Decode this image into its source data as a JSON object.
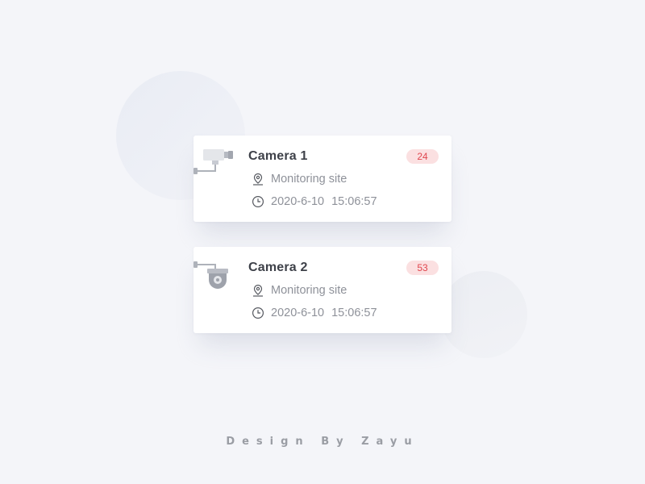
{
  "cameras": [
    {
      "name": "Camera 1",
      "count": "24",
      "location": "Monitoring site",
      "date": "2020-6-10",
      "time": "15:06:57",
      "icon": "bullet-camera-icon"
    },
    {
      "name": "Camera 2",
      "count": "53",
      "location": "Monitoring site",
      "date": "2020-6-10",
      "time": "15:06:57",
      "icon": "dome-camera-icon"
    }
  ],
  "footer": {
    "credit": "Design By Zayu"
  },
  "colors": {
    "background": "#f4f5f9",
    "card": "#ffffff",
    "badge_bg": "#fbe0e1",
    "badge_text": "#e0474f",
    "title": "#3e4149",
    "meta": "#8e9199"
  }
}
